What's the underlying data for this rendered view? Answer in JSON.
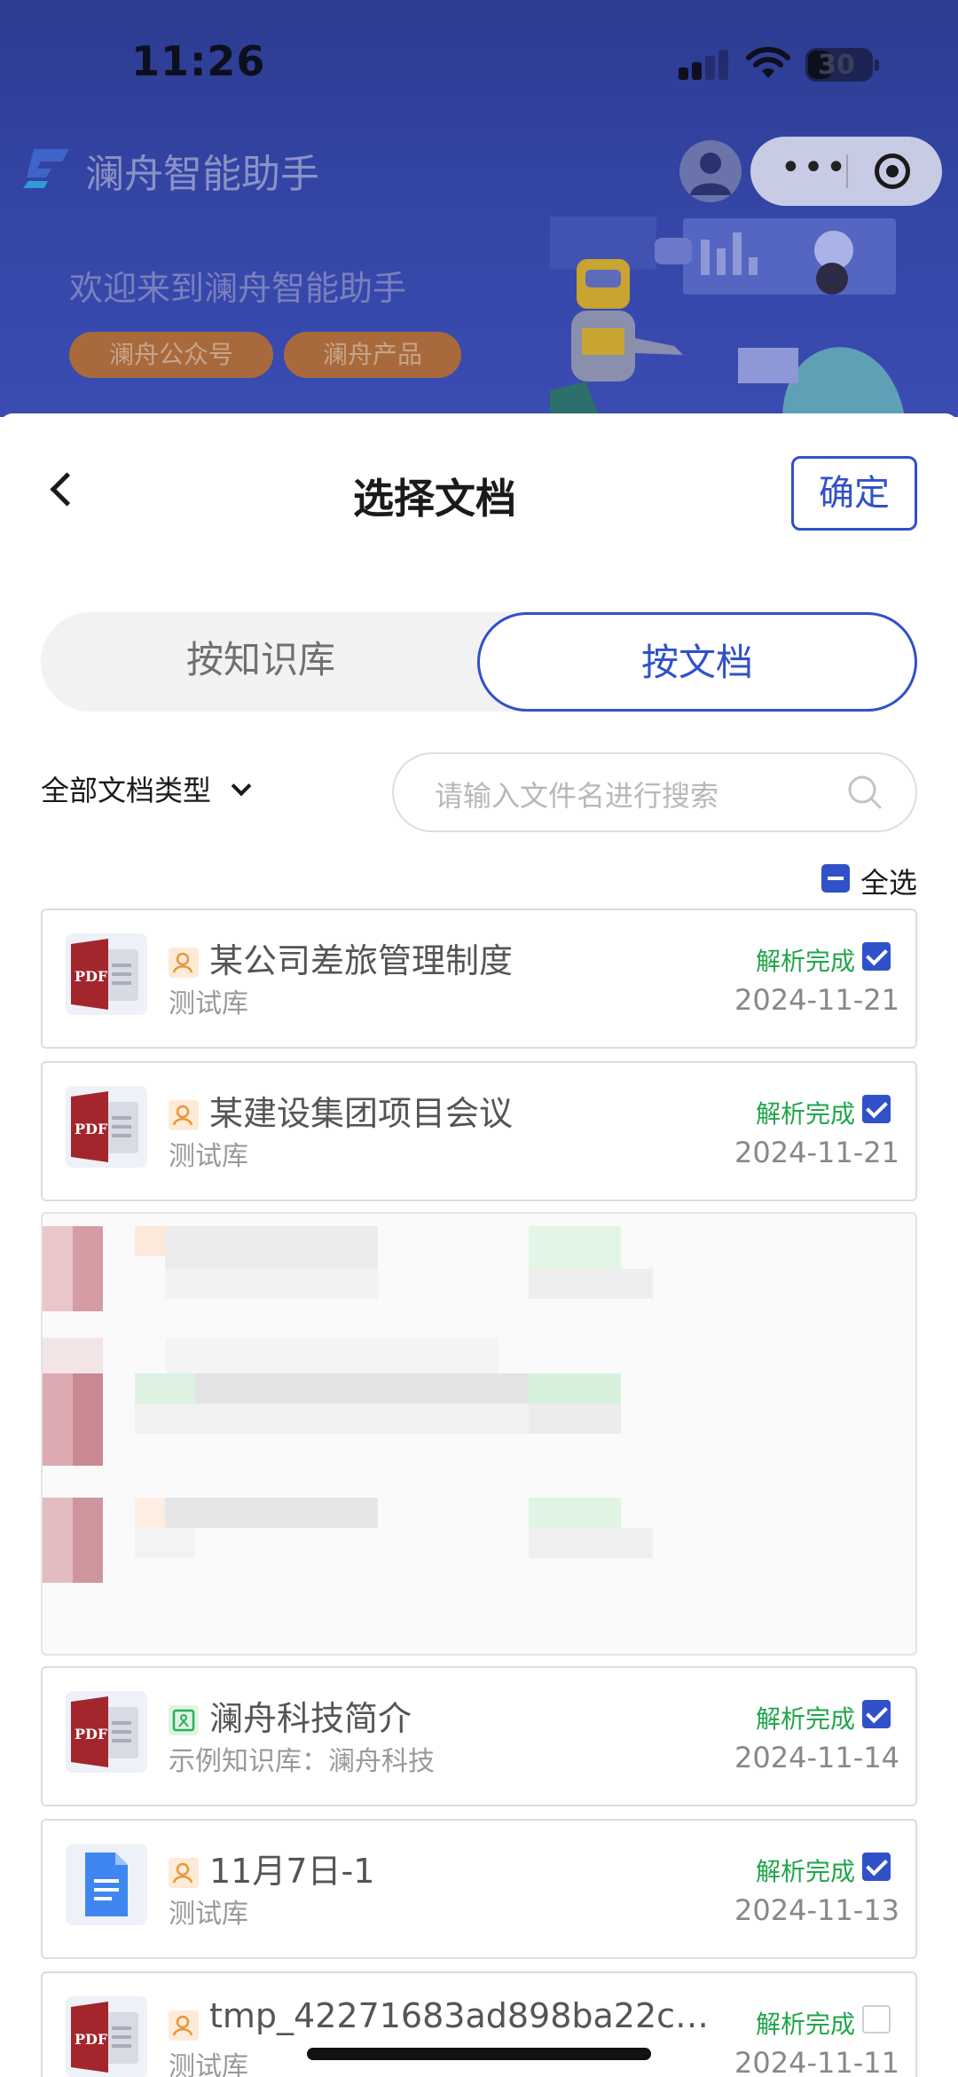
{
  "status_bar": {
    "time": "11:26",
    "battery": "30"
  },
  "header": {
    "app_title": "澜舟智能助手",
    "welcome": "欢迎来到澜舟智能助手",
    "pills": [
      "澜舟公众号",
      "澜舟产品"
    ],
    "more_icon": "more-dots-icon",
    "close_icon": "target-icon"
  },
  "sheet": {
    "title": "选择文档",
    "confirm_label": "确定",
    "tabs": [
      {
        "label": "按知识库",
        "active": false
      },
      {
        "label": "按文档",
        "active": true
      }
    ],
    "type_filter": "全部文档类型",
    "search_placeholder": "请输入文件名进行搜索",
    "select_all_label": "全选",
    "accent_color": "#3151c9",
    "status_color": "#21a64a"
  },
  "documents": [
    {
      "name": "某公司差旅管理制度",
      "library": "测试库",
      "status": "解析完成",
      "date": "2024-11-21",
      "file_type": "pdf",
      "source": "personal",
      "checked": true
    },
    {
      "name": "某建设集团项目会议",
      "library": "测试库",
      "status": "解析完成",
      "date": "2024-11-21",
      "file_type": "pdf",
      "source": "personal",
      "checked": true
    },
    {
      "name": "澜舟科技简介",
      "library": "示例知识库：澜舟科技",
      "status": "解析完成",
      "date": "2024-11-14",
      "file_type": "pdf",
      "source": "knowledge-base",
      "checked": true
    },
    {
      "name": "11月7日-1",
      "library": "测试库",
      "status": "解析完成",
      "date": "2024-11-13",
      "file_type": "doc",
      "source": "personal",
      "checked": true
    },
    {
      "name": "tmp_42271683ad898ba22c3c...",
      "library": "测试库",
      "status": "解析完成",
      "date": "2024-11-11",
      "file_type": "pdf",
      "source": "personal",
      "checked": false
    }
  ]
}
